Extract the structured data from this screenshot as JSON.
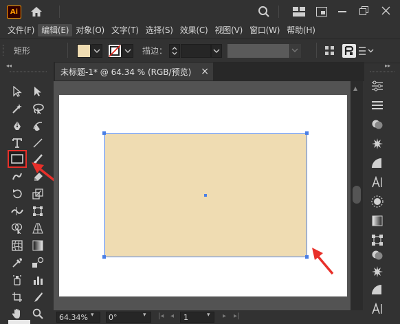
{
  "app": {
    "logo_text": "Ai"
  },
  "menu": {
    "items": [
      {
        "label": "文件(F)"
      },
      {
        "label": "编辑(E)"
      },
      {
        "label": "对象(O)"
      },
      {
        "label": "文字(T)"
      },
      {
        "label": "选择(S)"
      },
      {
        "label": "效果(C)"
      },
      {
        "label": "视图(V)"
      },
      {
        "label": "窗口(W)"
      },
      {
        "label": "帮助(H)"
      }
    ]
  },
  "control": {
    "object_type": "矩形",
    "fill_color": "#efdcb2",
    "stroke_label": "描边："
  },
  "document": {
    "tab_title": "未标题-1* @ 64.34 % (RGB/预览)",
    "close_glyph": "×"
  },
  "shape": {
    "fill_color": "#efdcb2",
    "selection_color": "#4a7fe6"
  },
  "annotation": {
    "highlight_color": "#e8302a"
  },
  "status": {
    "zoom": "64.34%",
    "rotation": "0°",
    "artboard_number": "1"
  }
}
